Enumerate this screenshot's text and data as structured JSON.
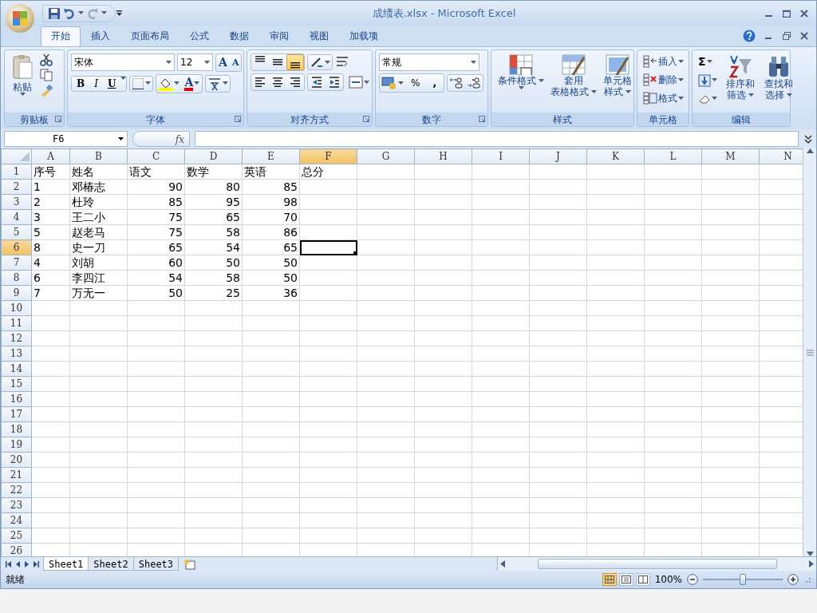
{
  "window": {
    "title": "成绩表.xlsx - Microsoft Excel"
  },
  "ribbon_tabs": [
    {
      "label": "开始",
      "selected": true
    },
    {
      "label": "插入",
      "selected": false
    },
    {
      "label": "页面布局",
      "selected": false
    },
    {
      "label": "公式",
      "selected": false
    },
    {
      "label": "数据",
      "selected": false
    },
    {
      "label": "审阅",
      "selected": false
    },
    {
      "label": "视图",
      "selected": false
    },
    {
      "label": "加载项",
      "selected": false
    }
  ],
  "ribbon": {
    "clipboard": {
      "label": "剪贴板",
      "paste": "粘贴"
    },
    "font": {
      "label": "字体",
      "font_name": "宋体",
      "font_size": "12",
      "grow": "A",
      "shrink": "A",
      "bold": "B",
      "italic": "I",
      "underline": "U",
      "font_color": "A"
    },
    "alignment": {
      "label": "对齐方式",
      "vertical": [
        {
          "selected": false
        },
        {
          "selected": false
        },
        {
          "selected": true
        }
      ],
      "horizontal": [
        {
          "selected": false
        },
        {
          "selected": false
        },
        {
          "selected": false
        }
      ]
    },
    "number": {
      "label": "数字",
      "format": "常规",
      "percent": "%",
      "comma": ","
    },
    "styles": {
      "label": "样式",
      "conditional": [
        "条件格式"
      ],
      "table_format": [
        "套用",
        "表格格式"
      ],
      "cell_styles": [
        "单元格",
        "样式"
      ]
    },
    "cells": {
      "label": "单元格",
      "insert": "插入",
      "delete": "删除",
      "format": "格式"
    },
    "editing": {
      "label": "编辑",
      "sum": "Σ",
      "sort": [
        "排序和",
        "筛选"
      ],
      "find": [
        "查找和",
        "选择"
      ]
    }
  },
  "formula_bar": {
    "name_box": "F6",
    "function_label": "fx"
  },
  "columns": [
    {
      "label": "A",
      "selected": false
    },
    {
      "label": "B",
      "selected": false
    },
    {
      "label": "C",
      "selected": false
    },
    {
      "label": "D",
      "selected": false
    },
    {
      "label": "E",
      "selected": false
    },
    {
      "label": "F",
      "selected": true
    },
    {
      "label": "G",
      "selected": false
    },
    {
      "label": "H",
      "selected": false
    },
    {
      "label": "I",
      "selected": false
    },
    {
      "label": "J",
      "selected": false
    },
    {
      "label": "K",
      "selected": false
    },
    {
      "label": "L",
      "selected": false
    },
    {
      "label": "M",
      "selected": false
    },
    {
      "label": "N",
      "selected": false
    }
  ],
  "rows": [
    {
      "label": "1",
      "selected": false,
      "cells": [
        "序号",
        "姓名",
        "语文",
        "数学",
        "英语",
        "总分"
      ]
    },
    {
      "label": "2",
      "selected": false,
      "cells": [
        "1",
        "邓椿志"
      ],
      "scores": [
        "90",
        "80",
        "85"
      ]
    },
    {
      "label": "3",
      "selected": false,
      "cells": [
        "2",
        "杜玲"
      ],
      "scores": [
        "85",
        "95",
        "98"
      ]
    },
    {
      "label": "4",
      "selected": false,
      "cells": [
        "3",
        "王二小"
      ],
      "scores": [
        "75",
        "65",
        "70"
      ]
    },
    {
      "label": "5",
      "selected": false,
      "cells": [
        "5",
        "赵老马"
      ],
      "scores": [
        "75",
        "58",
        "86"
      ]
    },
    {
      "label": "6",
      "selected": true,
      "cells": [
        "8",
        "史一刀"
      ],
      "scores": [
        "65",
        "54",
        "65"
      ]
    },
    {
      "label": "7",
      "selected": false,
      "cells": [
        "4",
        "刘胡"
      ],
      "scores": [
        "60",
        "50",
        "50"
      ]
    },
    {
      "label": "8",
      "selected": false,
      "cells": [
        "6",
        "李四江"
      ],
      "scores": [
        "54",
        "58",
        "50"
      ]
    },
    {
      "label": "9",
      "selected": false,
      "cells": [
        "7",
        "万无一"
      ],
      "scores": [
        "50",
        "25",
        "36"
      ]
    },
    {
      "label": "10",
      "selected": false
    },
    {
      "label": "11",
      "selected": false
    },
    {
      "label": "12",
      "selected": false
    },
    {
      "label": "13",
      "selected": false
    },
    {
      "label": "14",
      "selected": false
    },
    {
      "label": "15",
      "selected": false
    },
    {
      "label": "16",
      "selected": false
    },
    {
      "label": "17",
      "selected": false
    },
    {
      "label": "18",
      "selected": false
    },
    {
      "label": "19",
      "selected": false
    },
    {
      "label": "20",
      "selected": false
    },
    {
      "label": "21",
      "selected": false
    },
    {
      "label": "22",
      "selected": false
    },
    {
      "label": "23",
      "selected": false
    },
    {
      "label": "24",
      "selected": false
    },
    {
      "label": "25",
      "selected": false
    },
    {
      "label": "26",
      "selected": false
    }
  ],
  "sheet_tabs": [
    {
      "label": "Sheet1",
      "selected": true
    },
    {
      "label": "Sheet2",
      "selected": false
    },
    {
      "label": "Sheet3",
      "selected": false
    }
  ],
  "status_bar": {
    "status": "就绪",
    "views": [
      {
        "selected": true
      },
      {
        "selected": false
      },
      {
        "selected": false
      }
    ],
    "zoom": "100%",
    "zoom_slider": {
      "level": 0.5
    }
  }
}
